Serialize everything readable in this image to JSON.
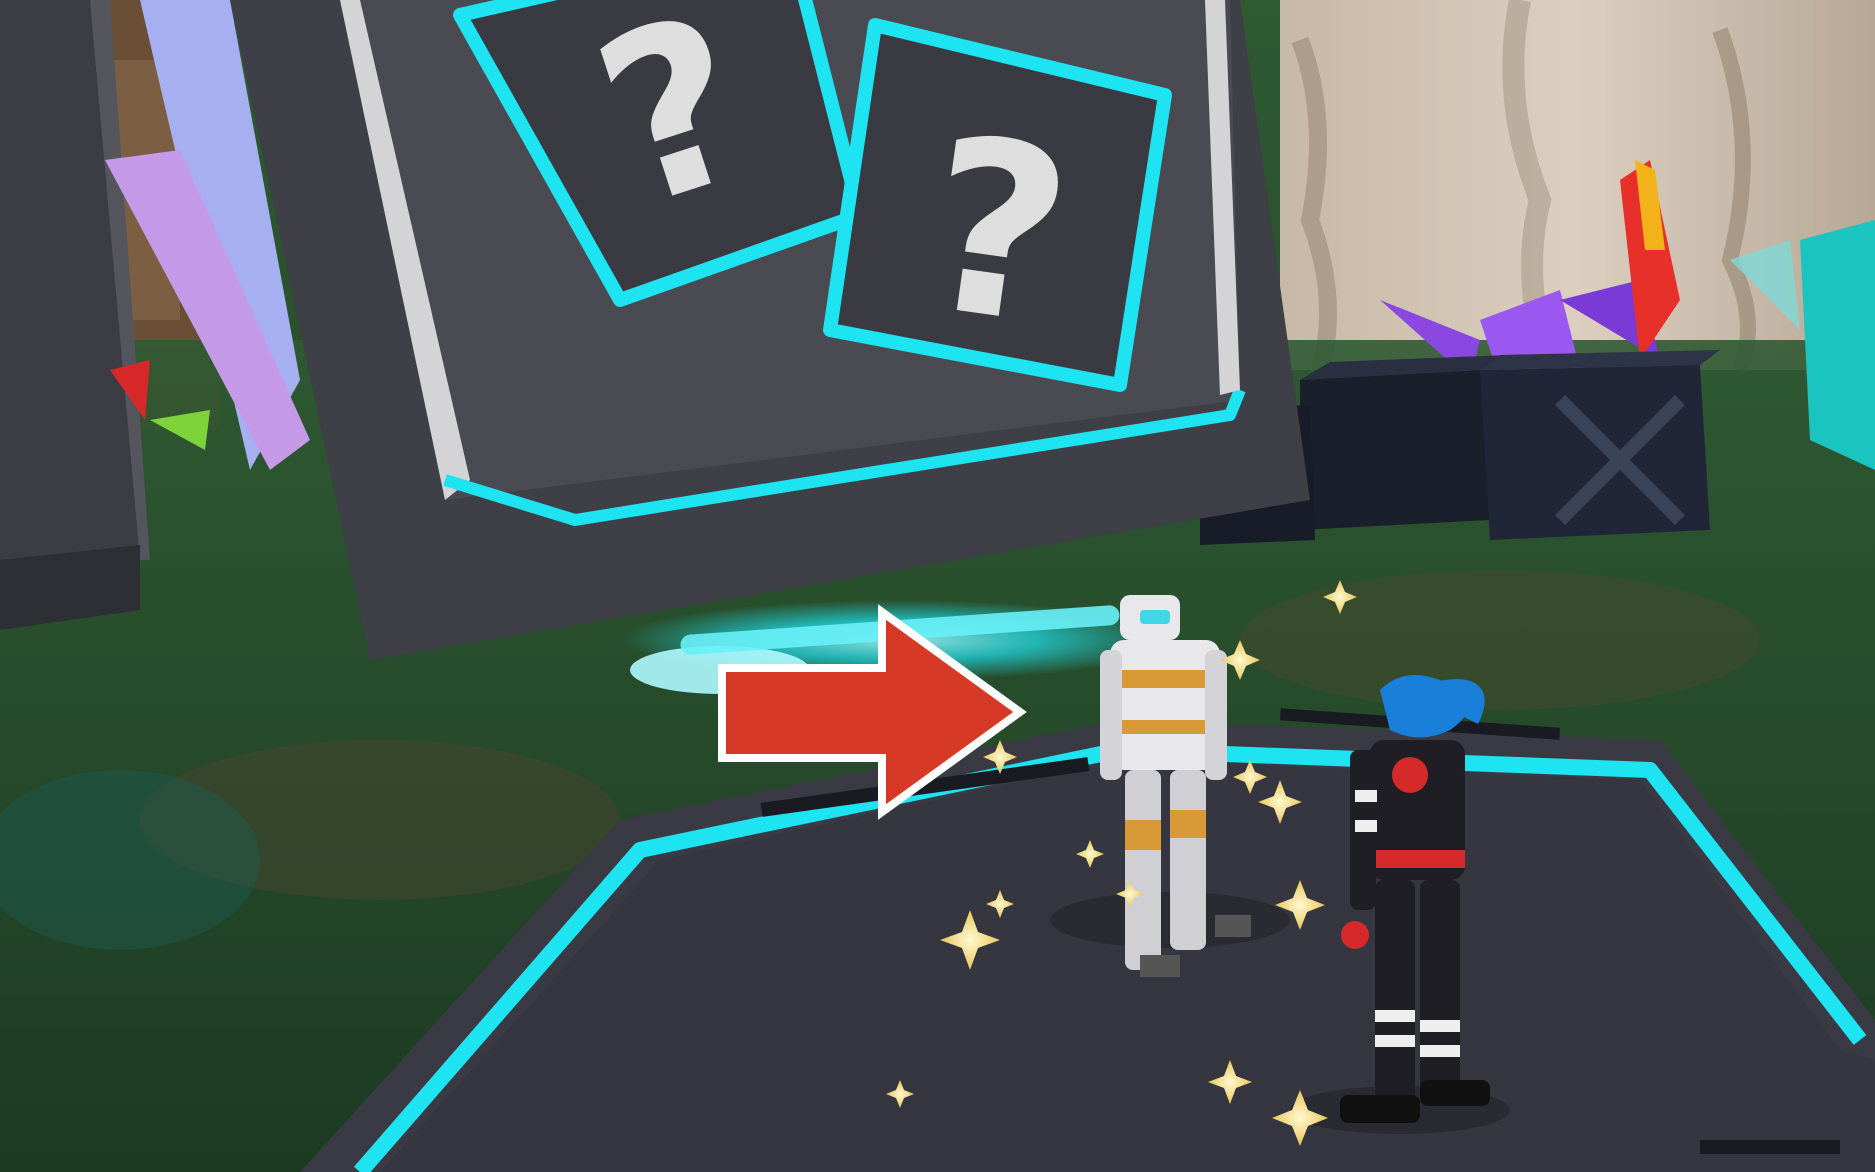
{
  "sign": {
    "glyph_left": "?",
    "glyph_right": "?",
    "panel_color": "#4a4a52",
    "accent_color": "#1ee3f0",
    "glyph_color": "#dedede"
  },
  "arrow": {
    "color": "#d63a26",
    "outline": "#ffffff",
    "direction": "right"
  },
  "platform": {
    "color": "#3a3a44",
    "trim_color": "#1ee3f0"
  },
  "characters": [
    {
      "id": "npc-robot",
      "suit": "white-orange"
    },
    {
      "id": "player-avatar",
      "suit": "black-red",
      "hair": "blue"
    }
  ]
}
